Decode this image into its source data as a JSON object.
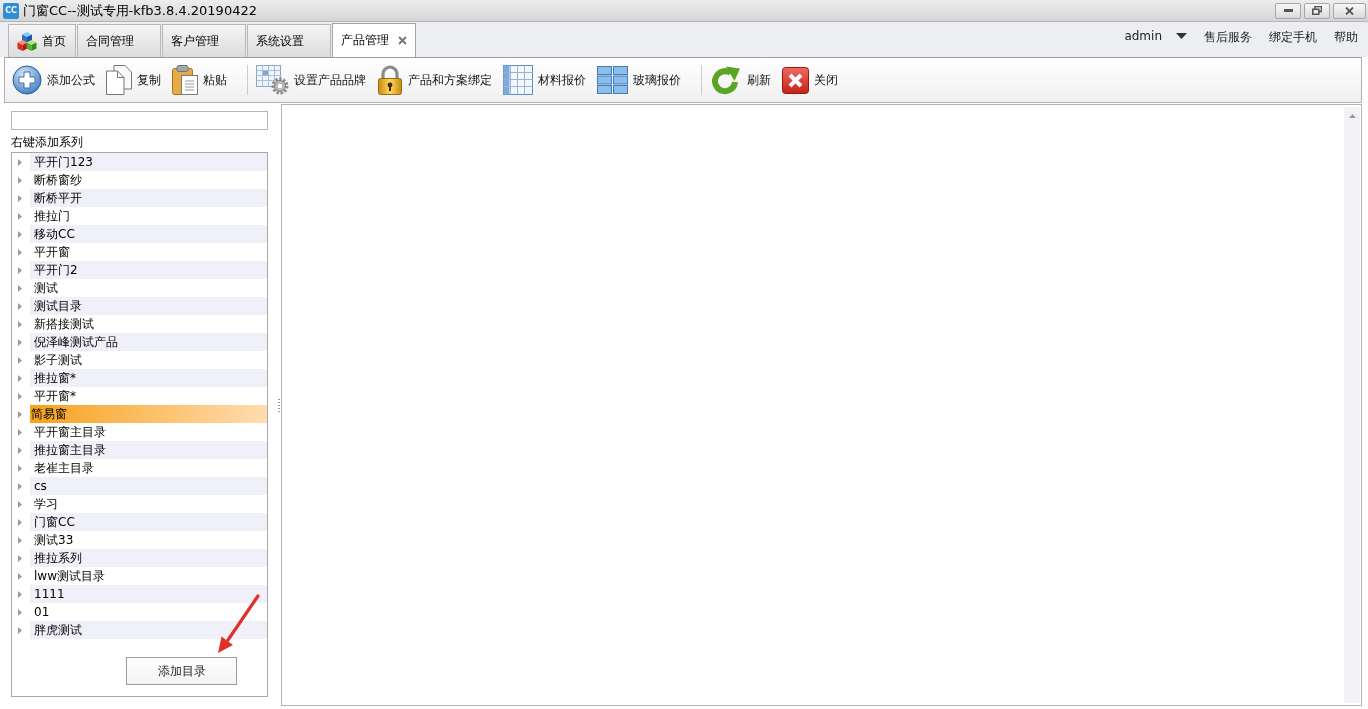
{
  "window": {
    "logo": "CC",
    "title": "门窗CC--测试专用-kfb3.8.4.20190422"
  },
  "tabs": [
    {
      "label": "首页",
      "kind": "home",
      "selected": false,
      "closable": false
    },
    {
      "label": "合同管理",
      "kind": "page",
      "selected": false,
      "closable": false
    },
    {
      "label": "客户管理",
      "kind": "page",
      "selected": false,
      "closable": false
    },
    {
      "label": "系统设置",
      "kind": "page",
      "selected": false,
      "closable": false
    },
    {
      "label": "产品管理",
      "kind": "page",
      "selected": true,
      "closable": true
    }
  ],
  "user_menu": {
    "user": "admin",
    "links": [
      "售后服务",
      "绑定手机",
      "帮助"
    ]
  },
  "toolbar": {
    "groups": [
      [
        {
          "label": "添加公式",
          "kind": "add"
        },
        {
          "label": "复制",
          "kind": "copy"
        },
        {
          "label": "粘贴",
          "kind": "paste"
        }
      ],
      [
        {
          "label": "设置产品品牌",
          "kind": "brand"
        },
        {
          "label": "产品和方案绑定",
          "kind": "lock"
        },
        {
          "label": "材料报价",
          "kind": "material"
        },
        {
          "label": "玻璃报价",
          "kind": "glass"
        }
      ],
      [
        {
          "label": "刷新",
          "kind": "refresh"
        },
        {
          "label": "关闭",
          "kind": "close"
        }
      ]
    ]
  },
  "sidebar": {
    "hint": "右键添加系列",
    "tree": [
      {
        "label": "平开门123",
        "selected": false,
        "expanded": false
      },
      {
        "label": "断桥窗纱",
        "selected": false,
        "expanded": false
      },
      {
        "label": "断桥平开",
        "selected": false,
        "expanded": false
      },
      {
        "label": "推拉门",
        "selected": false,
        "expanded": false
      },
      {
        "label": "移动CC",
        "selected": false,
        "expanded": false
      },
      {
        "label": "平开窗",
        "selected": false,
        "expanded": false
      },
      {
        "label": "平开门2",
        "selected": false,
        "expanded": false
      },
      {
        "label": "测试",
        "selected": false,
        "expanded": false
      },
      {
        "label": "测试目录",
        "selected": false,
        "expanded": false
      },
      {
        "label": "新搭接测试",
        "selected": false,
        "expanded": false
      },
      {
        "label": "倪泽峰测试产品",
        "selected": false,
        "expanded": false
      },
      {
        "label": "影子测试",
        "selected": false,
        "expanded": false
      },
      {
        "label": "推拉窗*",
        "selected": false,
        "expanded": false
      },
      {
        "label": "平开窗*",
        "selected": false,
        "expanded": false
      },
      {
        "label": "简易窗",
        "selected": true,
        "expanded": false
      },
      {
        "label": "平开窗主目录",
        "selected": false,
        "expanded": false
      },
      {
        "label": "推拉窗主目录",
        "selected": false,
        "expanded": false
      },
      {
        "label": "老崔主目录",
        "selected": false,
        "expanded": false
      },
      {
        "label": "cs",
        "selected": false,
        "expanded": false
      },
      {
        "label": "学习",
        "selected": false,
        "expanded": false
      },
      {
        "label": "门窗CC",
        "selected": false,
        "expanded": false
      },
      {
        "label": "测试33",
        "selected": false,
        "expanded": false
      },
      {
        "label": "推拉系列",
        "selected": false,
        "expanded": false
      },
      {
        "label": "lww测试目录",
        "selected": false,
        "expanded": false
      },
      {
        "label": "1111",
        "selected": false,
        "expanded": false
      },
      {
        "label": "01",
        "selected": false,
        "expanded": false
      },
      {
        "label": "胖虎测试",
        "selected": false,
        "expanded": false
      }
    ],
    "button": "添加目录"
  }
}
